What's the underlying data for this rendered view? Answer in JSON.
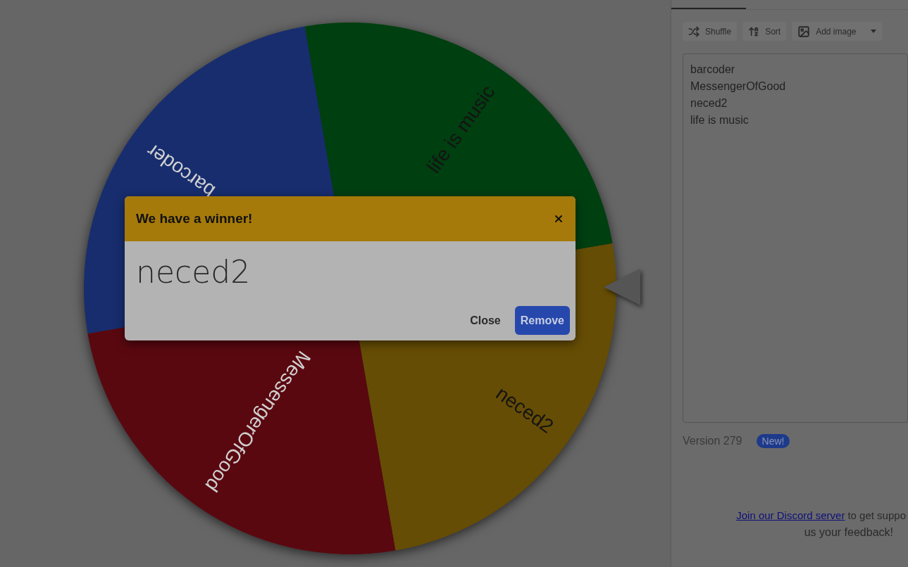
{
  "wheel": {
    "segments": [
      {
        "label": "neced2",
        "color": "#664d05"
      },
      {
        "label": "MessengerOfGood",
        "color": "#5a0810"
      },
      {
        "label": "barcoder",
        "color": "#172d6e"
      },
      {
        "label": "life is music",
        "color": "#003f10"
      }
    ]
  },
  "dialog": {
    "title": "We have a winner!",
    "winner": "neced2",
    "buttons": [
      {
        "label": "Close",
        "kind": "text"
      },
      {
        "label": "Remove",
        "kind": "primary"
      }
    ]
  },
  "toolbar": [
    {
      "label": "Shuffle",
      "kind": "shuffle"
    },
    {
      "label": "Sort",
      "kind": "sort"
    },
    {
      "label": "Add image",
      "kind": "image"
    }
  ],
  "entries": [
    "barcoder",
    "MessengerOfGood",
    "neced2",
    "life is music"
  ],
  "version": {
    "text": "Version 279",
    "badge": "New!"
  },
  "footer": {
    "link": "Join our Discord server",
    "line_1": "to get suppo",
    "line_2": "us your feedback!"
  }
}
